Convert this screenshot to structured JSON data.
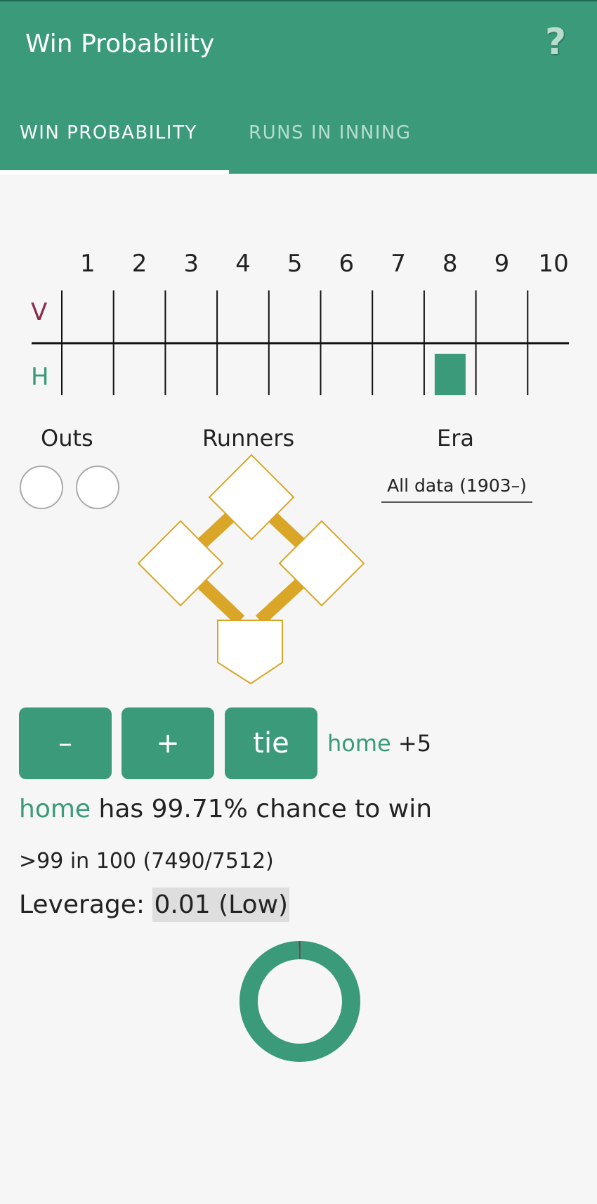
{
  "header": {
    "title": "Win Probability",
    "help_icon": "?"
  },
  "tabs": [
    {
      "label": "WIN PROBABILITY",
      "active": true
    },
    {
      "label": "RUNS IN INNING",
      "active": false
    }
  ],
  "scoreboard": {
    "innings": [
      "1",
      "2",
      "3",
      "4",
      "5",
      "6",
      "7",
      "8",
      "9",
      "10"
    ],
    "visitor_label": "V",
    "home_label": "H",
    "current_inning": 8,
    "current_half": "bottom"
  },
  "outs": {
    "label": "Outs",
    "count": 0
  },
  "runners": {
    "label": "Runners",
    "first": false,
    "second": false,
    "third": false
  },
  "era": {
    "label": "Era",
    "selected": "All data (1903–)"
  },
  "buttons": {
    "minus": "–",
    "plus": "+",
    "tie": "tie"
  },
  "score": {
    "team": "home",
    "diff": "+5"
  },
  "result": {
    "team": "home",
    "text": "has 99.71% chance to win",
    "odds": ">99 in 100 (7490/7512)",
    "leverage_label": "Leverage:",
    "leverage_value": "0.01 (Low)"
  },
  "win_probability_percent": 99.71,
  "colors": {
    "accent": "#3a9a7a",
    "visitor": "#8b2a4a",
    "bases": "#d9a628"
  }
}
